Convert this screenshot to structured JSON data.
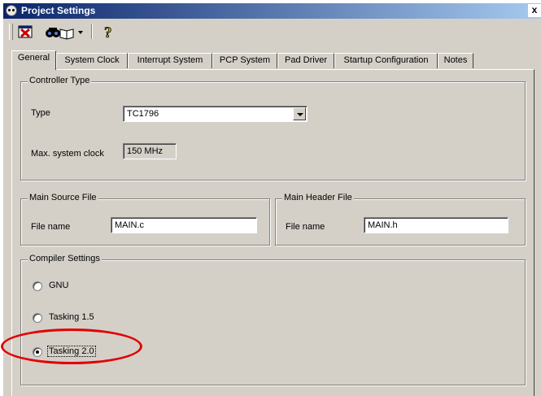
{
  "window": {
    "title": "Project Settings",
    "close_glyph": "x"
  },
  "toolbar": {
    "buttons": [
      {
        "name": "close-project-icon",
        "accent": "#cc0000"
      },
      {
        "name": "binoculars-book-icon"
      },
      {
        "name": "chevron-down-icon"
      },
      {
        "name": "help-question-icon",
        "accent": "#c8b400",
        "glyph": "?"
      }
    ]
  },
  "tabs": [
    {
      "label": "General",
      "active": true
    },
    {
      "label": "System Clock"
    },
    {
      "label": "Interrupt System"
    },
    {
      "label": "PCP System"
    },
    {
      "label": "Pad Driver"
    },
    {
      "label": "Startup Configuration"
    },
    {
      "label": "Notes"
    }
  ],
  "controller": {
    "group_label": "Controller Type",
    "type_label": "Type",
    "type_value": "TC1796",
    "clock_label": "Max. system clock",
    "clock_value": "150 MHz"
  },
  "source_file": {
    "group_label": "Main Source File",
    "field_label": "File name",
    "value": "MAIN.c"
  },
  "header_file": {
    "group_label": "Main Header File",
    "field_label": "File name",
    "value": "MAIN.h"
  },
  "compiler": {
    "group_label": "Compiler Settings",
    "options": [
      {
        "label": "GNU",
        "selected": false
      },
      {
        "label": "Tasking 1.5",
        "selected": false
      },
      {
        "label": "Tasking 2.0",
        "selected": true
      }
    ]
  },
  "colors": {
    "annotation": "#e30000",
    "titlebar_start": "#0a246a",
    "titlebar_end": "#a6caf0",
    "face": "#d4d0c8"
  }
}
